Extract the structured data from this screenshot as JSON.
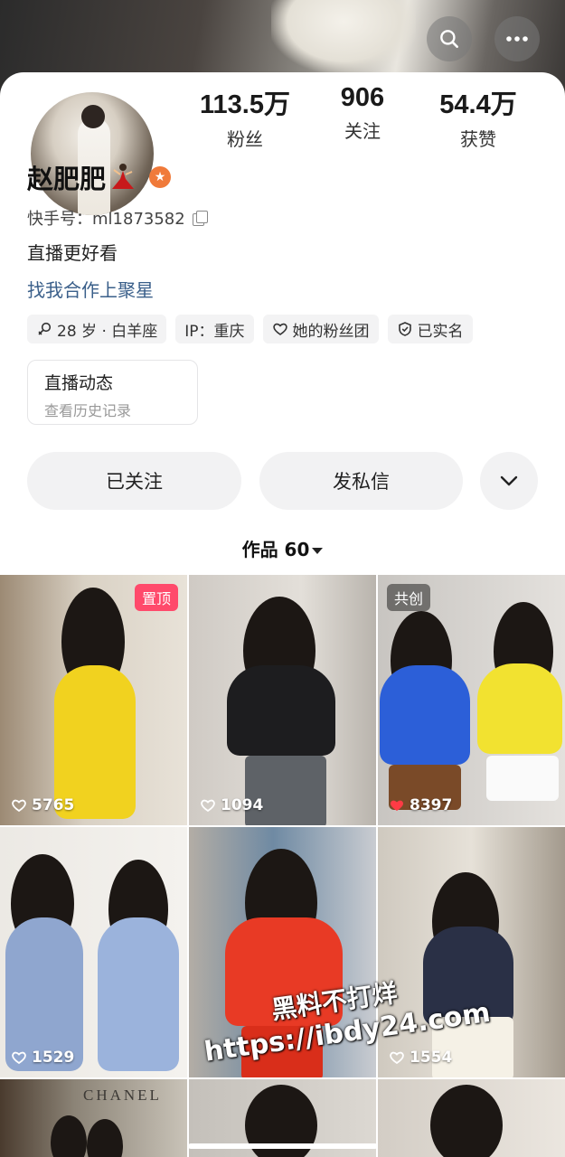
{
  "header": {
    "search_icon": "search-icon",
    "more_icon": "more-dots-icon"
  },
  "profile": {
    "name": "赵肥肥",
    "uid_label": "快手号：ml1873582",
    "bio": "直播更好看",
    "business_link": "找我合作上聚星",
    "badge_icon": "star-badge-icon"
  },
  "stats": [
    {
      "value": "113.5万",
      "label": "粉丝"
    },
    {
      "value": "906",
      "label": "关注"
    },
    {
      "value": "54.4万",
      "label": "获赞"
    }
  ],
  "tags": [
    {
      "icon": "gender-icon",
      "text": "28 岁 · 白羊座"
    },
    {
      "icon": "",
      "text": "IP：重庆"
    },
    {
      "icon": "heart-outline-icon",
      "text": "她的粉丝团"
    },
    {
      "icon": "shield-check-icon",
      "text": "已实名"
    }
  ],
  "live": {
    "title": "直播动态",
    "subtitle": "查看历史记录"
  },
  "actions": {
    "follow_label": "已关注",
    "message_label": "发私信",
    "more_icon": "chevron-down-icon"
  },
  "works": {
    "label": "作品 60"
  },
  "videos": [
    {
      "likes": "5765",
      "badge": "置顶",
      "colors": [
        "#e8e2d8",
        "#f1d21f"
      ]
    },
    {
      "likes": "1094",
      "badge": "",
      "colors": [
        "#d9d6d1",
        "#1d1d1f"
      ]
    },
    {
      "likes": "8397",
      "badge": "共创",
      "liked": true,
      "colors": [
        "#d7d4d0",
        "#2c5fd8"
      ]
    },
    {
      "likes": "1529",
      "badge": "",
      "colors": [
        "#ece9e4",
        "#8fa6cf"
      ]
    },
    {
      "likes": "",
      "badge": "",
      "colors": [
        "#c9ccd1",
        "#e83a25"
      ]
    },
    {
      "likes": "1554",
      "badge": "",
      "colors": [
        "#dcd6cc",
        "#2a3046"
      ]
    }
  ],
  "bottom_row_text": "CHANEL",
  "watermark": {
    "line1": "黑料不打烊",
    "line2": "https://ibdy24.com"
  }
}
